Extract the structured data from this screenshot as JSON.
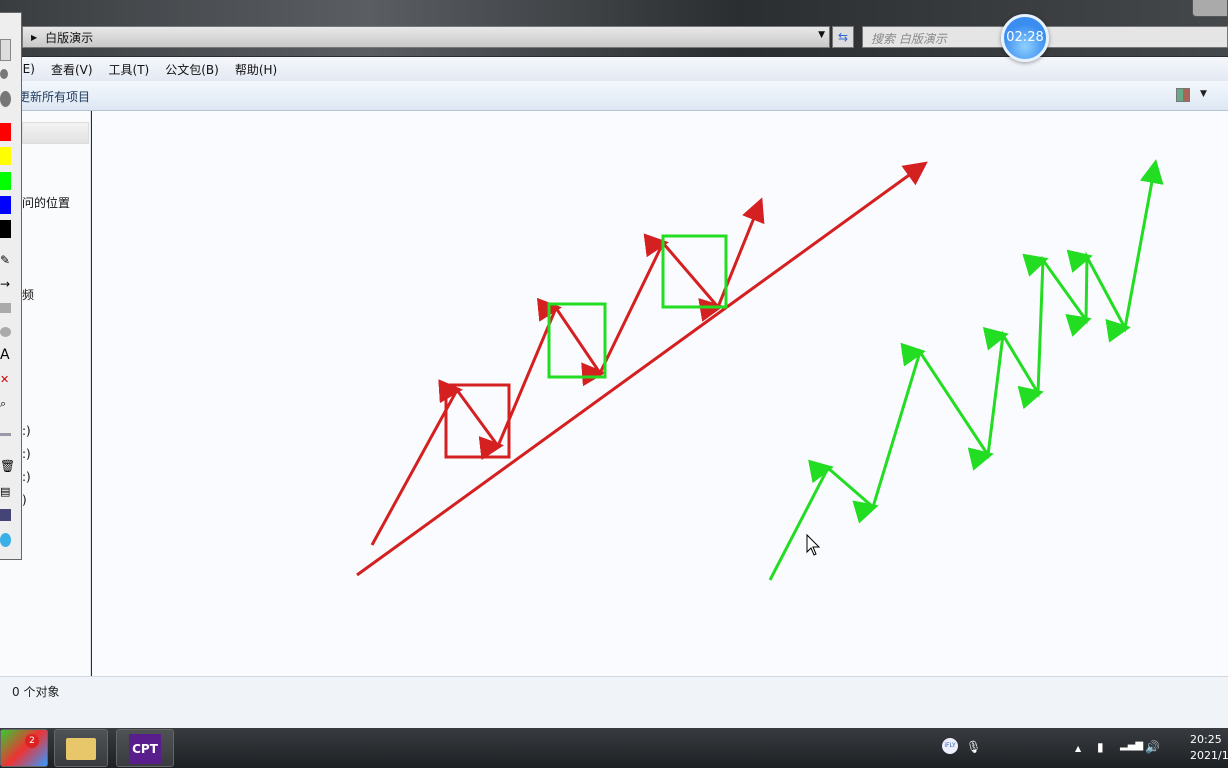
{
  "window": {
    "breadcrumb": "白版演示",
    "search_placeholder": "搜索 白版演示"
  },
  "timer": "02:28",
  "menu": [
    "(E)",
    "查看(V)",
    "工具(T)",
    "公文包(B)",
    "帮助(H)"
  ],
  "toolbar": {
    "update_all": "更新所有项目"
  },
  "nav": {
    "items": [
      "问的位置",
      "频",
      ":)",
      ":)",
      ":)",
      ")"
    ]
  },
  "status": {
    "text": "0 个对象"
  },
  "annotation_colors": {
    "red": "#d42020",
    "green": "#22dd22",
    "yellow": "#ffff00",
    "blue": "#0000ff",
    "black": "#000000"
  },
  "taskbar": {
    "badge": "2",
    "app_label": "CPT",
    "clock_time": "20:25",
    "clock_date": "2021/1"
  },
  "tray": {
    "ime": "iFLY"
  }
}
